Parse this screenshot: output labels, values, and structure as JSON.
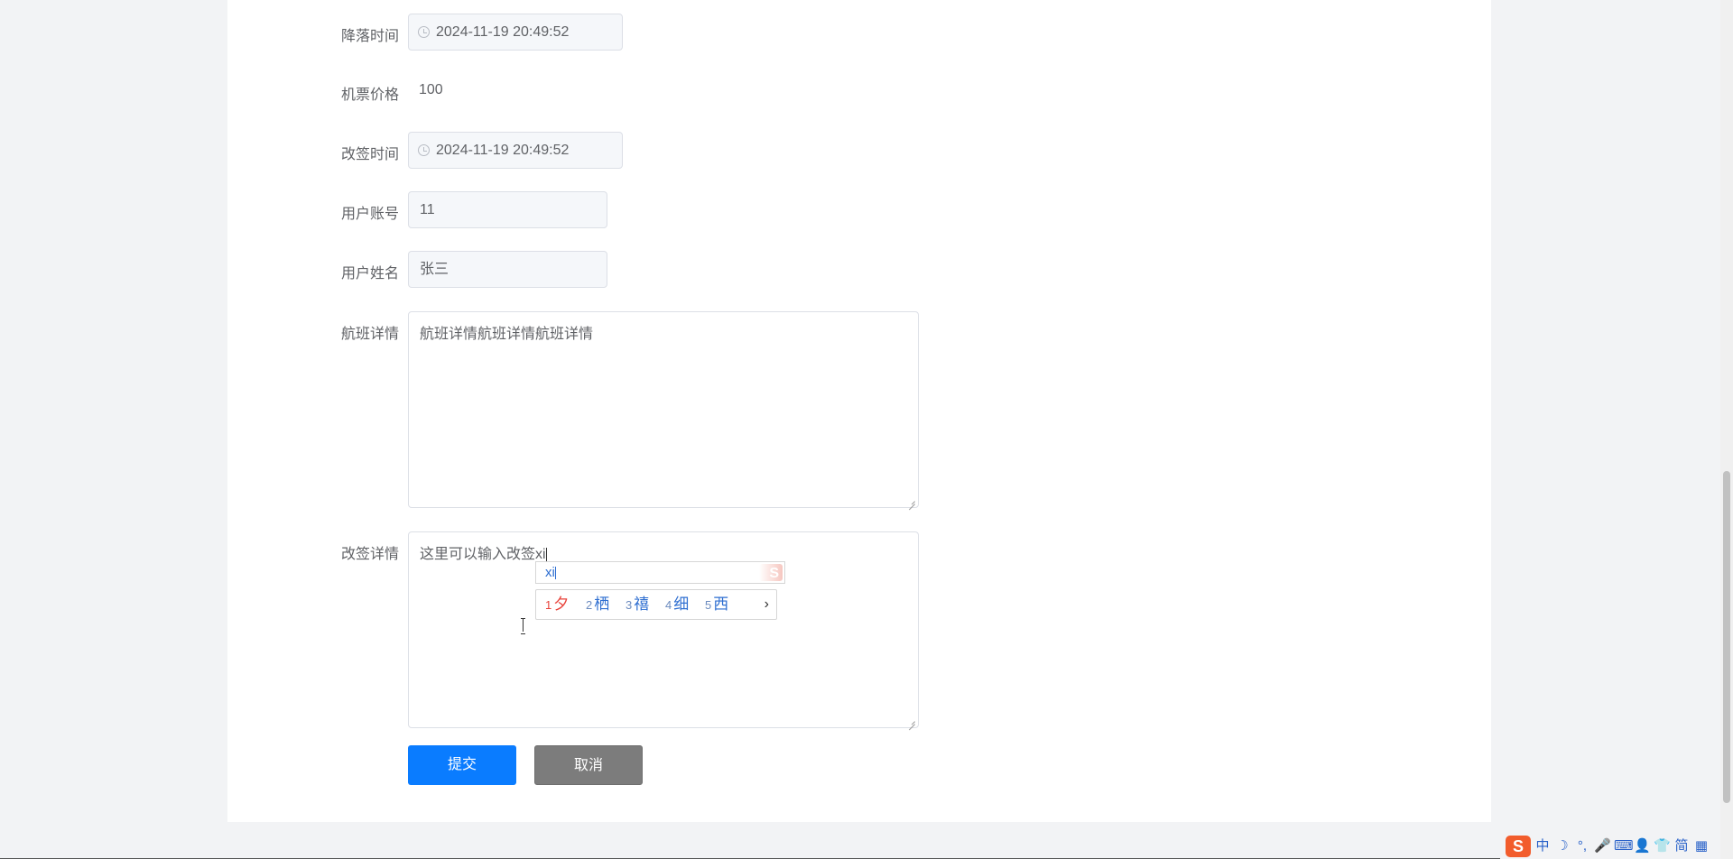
{
  "form": {
    "landing_time": {
      "label": "降落时间",
      "value": "2024-11-19 20:49:52"
    },
    "ticket_price": {
      "label": "机票价格",
      "value": "100"
    },
    "change_time": {
      "label": "改签时间",
      "value": "2024-11-19 20:49:52"
    },
    "user_account": {
      "label": "用户账号",
      "value": "11"
    },
    "user_name": {
      "label": "用户姓名",
      "value": "张三"
    },
    "flight_details": {
      "label": "航班详情",
      "value": "航班详情航班详情航班详情"
    },
    "change_details": {
      "label": "改签详情",
      "value": "这里可以输入改签xi"
    }
  },
  "buttons": {
    "submit": "提交",
    "cancel": "取消"
  },
  "ime": {
    "composition": "xi",
    "candidates": [
      {
        "num": "1",
        "char": "夕"
      },
      {
        "num": "2",
        "char": "栖"
      },
      {
        "num": "3",
        "char": "禧"
      },
      {
        "num": "4",
        "char": "细"
      },
      {
        "num": "5",
        "char": "西"
      }
    ],
    "next": "›",
    "logo_icon": "sogou-s-icon"
  },
  "tray": {
    "logo": "S",
    "items": [
      "中",
      "☽",
      "°,",
      "🎤",
      "⌨",
      "👤",
      "👕",
      "简",
      "▦"
    ]
  },
  "colors": {
    "primary": "#0a7cff",
    "cancel": "#7c7c7c",
    "ime_highlight": "#e8423a",
    "ime_text": "#2f6fd1"
  }
}
